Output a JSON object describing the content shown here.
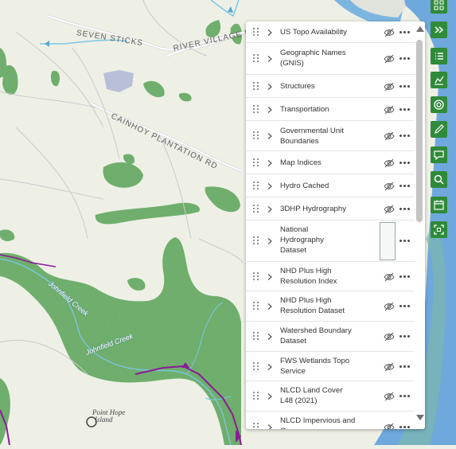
{
  "map": {
    "labels": {
      "seven_sticks": "SEVEN STICKS",
      "river_village": "RIVER VILLAGE DR",
      "cainhoy": "CAINHOY PLANTATION RD",
      "creek_upper": "Johnfield Creek",
      "creek_lower": "Johnfield Creek",
      "point_hope_line1": "Point Hope",
      "point_hope_line2": "Island"
    }
  },
  "layers": [
    {
      "label": "US Topo Availability"
    },
    {
      "label": "Geographic Names (GNIS)"
    },
    {
      "label": "Structures"
    },
    {
      "label": "Transportation"
    },
    {
      "label": "Governmental Unit Boundaries"
    },
    {
      "label": "Map Indices"
    },
    {
      "label": "Hydro Cached"
    },
    {
      "label": "3DHP Hydrography"
    },
    {
      "label": "National Hydrography Dataset"
    },
    {
      "label": "NHD Plus High Resolution Index"
    },
    {
      "label": "NHD Plus High Resolution Dataset"
    },
    {
      "label": "Watershed Boundary Dataset"
    },
    {
      "label": "FWS Wetlands Topo Service"
    },
    {
      "label": "NLCD Land Cover L48 (2021)"
    },
    {
      "label": "NLCD Impervious and Canopy"
    }
  ],
  "toolbar": [
    {
      "icon": "qr-grid-icon"
    },
    {
      "icon": "expand-chevrons-icon"
    },
    {
      "icon": "layer-list-icon"
    },
    {
      "icon": "chart-icon"
    },
    {
      "icon": "locate-target-icon"
    },
    {
      "icon": "pencil-icon"
    },
    {
      "icon": "speech-bubble-icon"
    },
    {
      "icon": "search-icon"
    },
    {
      "icon": "calendar-icon"
    },
    {
      "icon": "fit-extent-icon"
    }
  ],
  "colors": {
    "land": "#eef0e6",
    "forest": "#6fae6c",
    "water": "#6fa8dc",
    "toolbar": "#2f8a3a",
    "boundary": "#8b1a9a",
    "stream": "#7cc7e6"
  }
}
